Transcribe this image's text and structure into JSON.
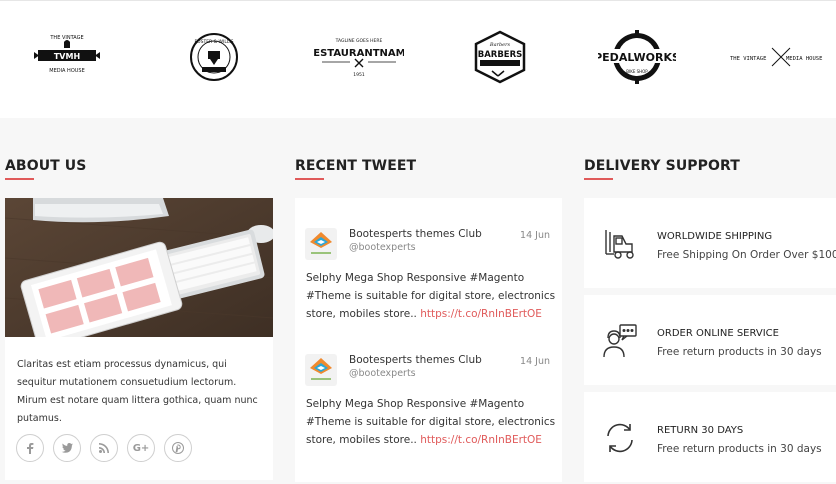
{
  "brands": [
    {
      "name": "brand-vintage-media-house",
      "top": "THE VINTAGE",
      "mid": "TVMH",
      "bottom": "MEDIA HOUSE"
    },
    {
      "name": "brand-foster-willis",
      "top": "FOSTER & WILLIS",
      "bottom": "MANUFACTURING"
    },
    {
      "name": "brand-restaurant-name",
      "top": "TAGLINE GOES HERE",
      "mid": "RESTAURANTNAME",
      "bottom": "1951"
    },
    {
      "name": "brand-barbers",
      "top": "Barbers",
      "mid": "BARBERS",
      "bottom": "BARBERSHOP"
    },
    {
      "name": "brand-pedalworks",
      "mid": "PEDALWORKS",
      "bottom": "BIKE SHOP"
    },
    {
      "name": "brand-vintage-media-house-2",
      "left": "THE VINTAGE",
      "right": "MEDIA HOUSE"
    }
  ],
  "about": {
    "title": "ABOUT US",
    "text": "Claritas est etiam processus dynamicus, qui sequitur mutationem consuetudium lectorum. Mirum est notare quam littera gothica, quam nunc putamus.",
    "social": [
      "facebook-icon",
      "twitter-icon",
      "rss-icon",
      "google-plus-icon",
      "pinterest-icon"
    ]
  },
  "tweets": {
    "title": "RECENT TWEET",
    "items": [
      {
        "name": "Bootesperts themes Club",
        "handle": "@bootexperts",
        "date": "14 Jun",
        "text": "Selphy Mega Shop Responsive #Magento #Theme is suitable for digital store, electronics store, mobiles store.. ",
        "link": "https://t.co/RnInBErtOE"
      },
      {
        "name": "Bootesperts themes Club",
        "handle": "@bootexperts",
        "date": "14 Jun",
        "text": "Selphy Mega Shop Responsive #Magento #Theme is suitable for digital store, electronics store, mobiles store.. ",
        "link": "https://t.co/RnInBErtOE"
      }
    ]
  },
  "delivery": {
    "title": "DELIVERY SUPPORT",
    "items": [
      {
        "icon": "forklift-icon",
        "title": "WORLDWIDE SHIPPING",
        "subtitle": "Free Shipping On Order Over $100"
      },
      {
        "icon": "support-agent-icon",
        "title": "ORDER ONLINE SERVICE",
        "subtitle": "Free return products in 30 days"
      },
      {
        "icon": "return-arrows-icon",
        "title": "RETURN 30 DAYS",
        "subtitle": "Free return products in 30 days"
      }
    ]
  },
  "colors": {
    "accent": "#e05a5a",
    "heading": "#222222",
    "background": "#f7f7f7",
    "card": "#ffffff"
  }
}
